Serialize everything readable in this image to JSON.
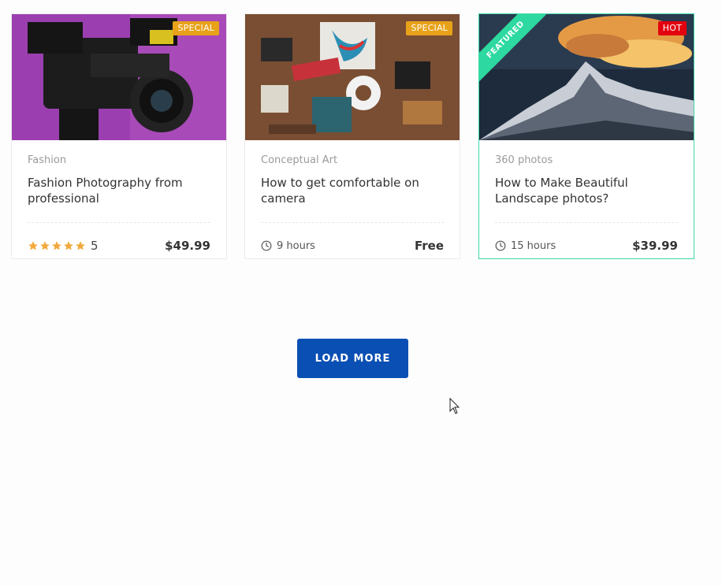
{
  "colors": {
    "special": "#e8a21a",
    "hot": "#e3000f",
    "featured": "#2dd9a0",
    "button": "#0a4fb3",
    "star": "#f2a93b"
  },
  "cards": [
    {
      "category": "Fashion",
      "title": "Fashion Photography from professional",
      "badge": "SPECIAL",
      "rating": "5",
      "price": "$49.99"
    },
    {
      "category": "Conceptual Art",
      "title": "How to get comfortable on camera",
      "badge": "SPECIAL",
      "duration": "9 hours",
      "price": "Free"
    },
    {
      "category": "360 photos",
      "title": "How to Make Beautiful Landscape photos?",
      "badge": "HOT",
      "ribbon": "FEATURED",
      "duration": "15 hours",
      "price": "$39.99"
    }
  ],
  "load_more": "LOAD MORE"
}
